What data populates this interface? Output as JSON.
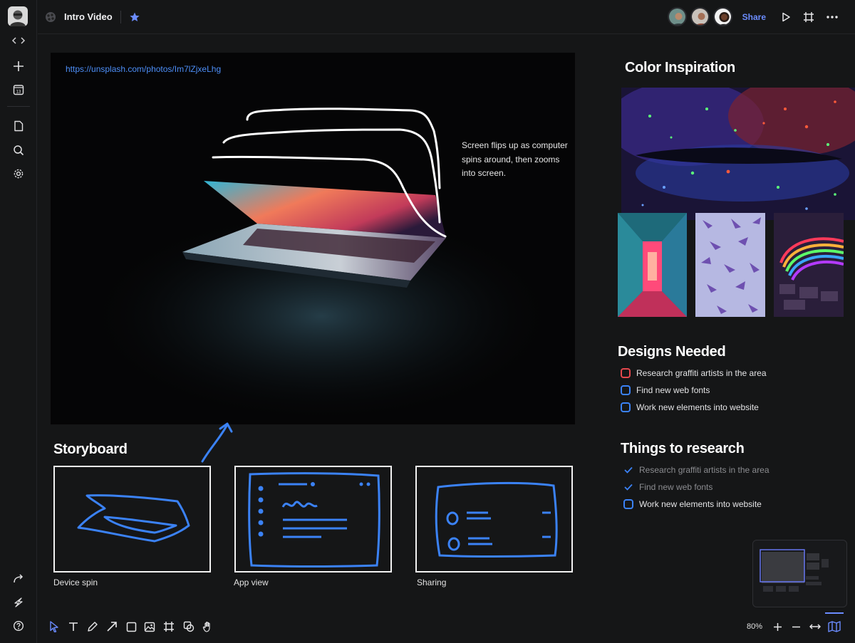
{
  "header": {
    "doc_title": "Intro Video",
    "share_label": "Share"
  },
  "canvas": {
    "photo_link": "https://unsplash.com/photos/Im7lZjxeLhg",
    "photo_note": "Screen flips up as computer spins around, then zooms into screen."
  },
  "storyboard": {
    "title": "Storyboard",
    "frames": [
      {
        "caption": "Device spin"
      },
      {
        "caption": "App view"
      },
      {
        "caption": "Sharing"
      }
    ]
  },
  "color_inspiration": {
    "title": "Color Inspiration"
  },
  "designs_needed": {
    "title": "Designs Needed",
    "items": [
      {
        "label": "Research graffiti artists in the area",
        "status": "open",
        "color": "#e5484d"
      },
      {
        "label": "Find new web fonts",
        "status": "open",
        "color": "#3b82f6"
      },
      {
        "label": "Work new elements into website",
        "status": "open",
        "color": "#3b82f6"
      }
    ]
  },
  "things_to_research": {
    "title": "Things to research",
    "items": [
      {
        "label": "Research graffiti artists in the area",
        "status": "done"
      },
      {
        "label": "Find new web fonts",
        "status": "done"
      },
      {
        "label": "Work new elements into website",
        "status": "open"
      }
    ]
  },
  "zoom": {
    "level": "80%"
  },
  "calendar_day": "13",
  "colors": {
    "accent": "#6b8cff",
    "link": "#4d8ef7",
    "sketch_blue": "#3b82f6",
    "todo_red": "#e5484d"
  }
}
